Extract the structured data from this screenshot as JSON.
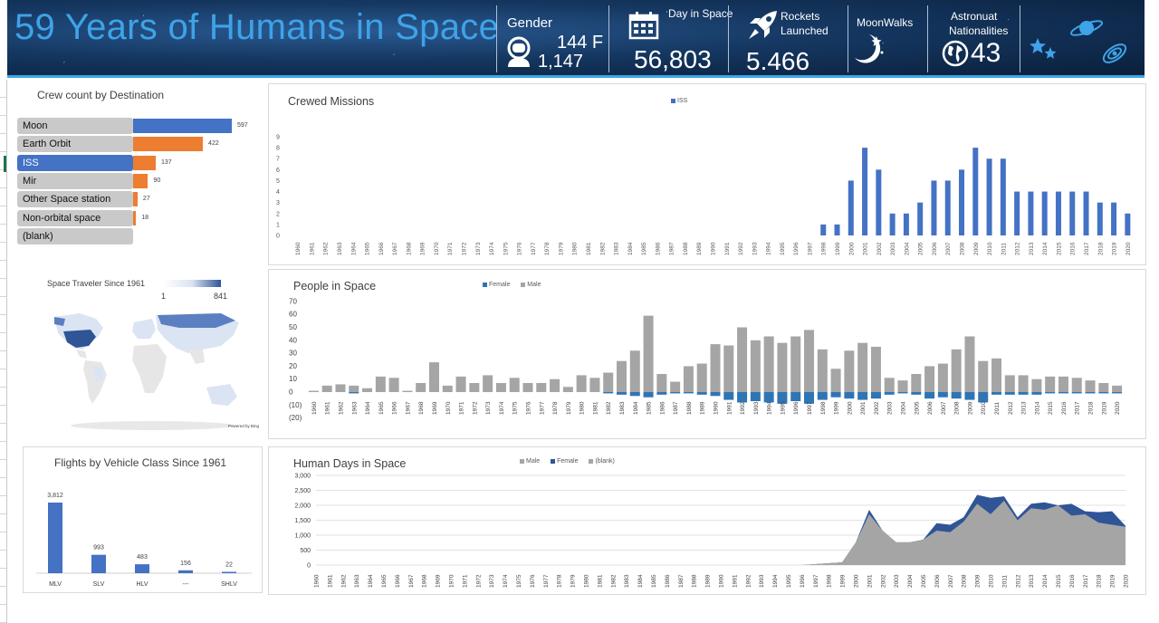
{
  "header": {
    "title": "59 Years of Humans in Space",
    "gender": {
      "label": "Gender",
      "female": "144 F",
      "male": "1,147"
    },
    "days": {
      "label": "Day in Space",
      "value": "56,803"
    },
    "rockets": {
      "label_line1": "Rockets",
      "label_line2": "Launched",
      "value": "5.466"
    },
    "moonwalks": {
      "label": "MoonWalks"
    },
    "nationalities": {
      "label_line1": "Astronuat",
      "label_line2": "Nationalities",
      "value": "43"
    },
    "icons": [
      "astronaut-icon",
      "calendar-icon",
      "rocket-icon",
      "moon-stars-icon",
      "globe-icon",
      "stars-icon",
      "planet-icon",
      "galaxy-icon"
    ],
    "accent": "#3ea3e8"
  },
  "crew_panel": {
    "title": "Crew count by Destination",
    "items": [
      {
        "label": "Moon",
        "value": "597",
        "selected": false,
        "color": "#4472c4"
      },
      {
        "label": "Earth Orbit",
        "value": "422",
        "selected": false,
        "color": "#ed7d31"
      },
      {
        "label": "ISS",
        "value": "137",
        "selected": true,
        "color": "#ed7d31"
      },
      {
        "label": "Mir",
        "value": "90",
        "selected": false,
        "color": "#ed7d31"
      },
      {
        "label": "Other Space station",
        "value": "27",
        "selected": false,
        "color": "#ed7d31"
      },
      {
        "label": "Non-orbital space",
        "value": "18",
        "selected": false,
        "color": "#ed7d31"
      },
      {
        "label": "(blank)",
        "value": "",
        "selected": false,
        "color": "#ed7d31"
      }
    ]
  },
  "map_panel": {
    "title": "Space Traveler Since 1961",
    "scale_min": "1",
    "scale_max": "841",
    "powered": "Powered by Bing"
  },
  "vehicle_panel": {
    "title": "Flights by Vehicle Class Since 1961"
  },
  "crewed_panel": {
    "title": "Crewed Missions",
    "legend": [
      "ISS"
    ]
  },
  "people_panel": {
    "title": "People  in Space",
    "legend": [
      "Female",
      "Male"
    ]
  },
  "days_panel": {
    "title": "Human Days in Space",
    "legend": [
      "Male",
      "Female",
      "(blank)"
    ]
  },
  "chart_data": [
    {
      "id": "crew_by_destination",
      "type": "bar",
      "orientation": "horizontal",
      "categories": [
        "Moon",
        "Earth Orbit",
        "ISS",
        "Mir",
        "Other Space station",
        "Non-orbital space",
        "(blank)"
      ],
      "values": [
        597,
        422,
        137,
        90,
        27,
        18,
        null
      ],
      "title": "Crew count by Destination"
    },
    {
      "id": "crewed_missions",
      "type": "bar",
      "title": "Crewed Missions",
      "years": [
        "1960",
        "1961",
        "1962",
        "1963",
        "1964",
        "1965",
        "1966",
        "1967",
        "1968",
        "1969",
        "1970",
        "1971",
        "1972",
        "1973",
        "1974",
        "1975",
        "1976",
        "1977",
        "1978",
        "1979",
        "1980",
        "1981",
        "1982",
        "1983",
        "1984",
        "1985",
        "1986",
        "1987",
        "1988",
        "1989",
        "1990",
        "1991",
        "1992",
        "1993",
        "1994",
        "1995",
        "1996",
        "1997",
        "1998",
        "1999",
        "2000",
        "2001",
        "2002",
        "2003",
        "2004",
        "2005",
        "2006",
        "2007",
        "2008",
        "2009",
        "2010",
        "2011",
        "2012",
        "2013",
        "2014",
        "2015",
        "2016",
        "2017",
        "2018",
        "2019",
        "2020"
      ],
      "series": [
        {
          "name": "ISS",
          "color": "#4472c4",
          "values": [
            0,
            0,
            0,
            0,
            0,
            0,
            0,
            0,
            0,
            0,
            0,
            0,
            0,
            0,
            0,
            0,
            0,
            0,
            0,
            0,
            0,
            0,
            0,
            0,
            0,
            0,
            0,
            0,
            0,
            0,
            0,
            0,
            0,
            0,
            0,
            0,
            0,
            0,
            1,
            1,
            5,
            8,
            6,
            2,
            2,
            3,
            5,
            5,
            6,
            8,
            7,
            7,
            4,
            4,
            4,
            4,
            4,
            4,
            3,
            3,
            2
          ]
        }
      ],
      "ylim": [
        0,
        9
      ],
      "yticks": [
        0,
        1,
        2,
        3,
        4,
        5,
        6,
        7,
        8,
        9
      ]
    },
    {
      "id": "people_in_space",
      "type": "bar",
      "title": "People  in Space",
      "years": [
        "1960",
        "1961",
        "1962",
        "1963",
        "1964",
        "1965",
        "1966",
        "1967",
        "1968",
        "1969",
        "1970",
        "1971",
        "1972",
        "1973",
        "1974",
        "1975",
        "1976",
        "1977",
        "1978",
        "1979",
        "1980",
        "1981",
        "1982",
        "1983",
        "1984",
        "1985",
        "1986",
        "1987",
        "1988",
        "1989",
        "1990",
        "1991",
        "1992",
        "1993",
        "1994",
        "1995",
        "1996",
        "1997",
        "1998",
        "1999",
        "2000",
        "2001",
        "2002",
        "2003",
        "2004",
        "2005",
        "2006",
        "2007",
        "2008",
        "2009",
        "2010",
        "2011",
        "2012",
        "2013",
        "2014",
        "2015",
        "2016",
        "2017",
        "2018",
        "2019",
        "2020"
      ],
      "series": [
        {
          "name": "Male",
          "color": "#a5a5a5",
          "values": [
            1,
            5,
            6,
            5,
            3,
            12,
            11,
            1,
            7,
            23,
            5,
            12,
            7,
            13,
            7,
            11,
            7,
            7,
            10,
            4,
            13,
            11,
            15,
            24,
            32,
            59,
            14,
            8,
            20,
            22,
            37,
            36,
            50,
            40,
            43,
            38,
            43,
            48,
            33,
            18,
            32,
            38,
            35,
            11,
            9,
            14,
            20,
            22,
            33,
            43,
            24,
            26,
            13,
            13,
            10,
            12,
            12,
            11,
            9,
            7,
            5
          ]
        },
        {
          "name": "Female",
          "color": "#2e75b6",
          "values": [
            0,
            0,
            0,
            -1,
            0,
            0,
            0,
            0,
            0,
            0,
            0,
            0,
            0,
            0,
            0,
            0,
            0,
            0,
            0,
            0,
            0,
            0,
            -1,
            -2,
            -3,
            -4,
            -2,
            -1,
            -1,
            -2,
            -3,
            -6,
            -8,
            -7,
            -8,
            -9,
            -7,
            -9,
            -6,
            -4,
            -5,
            -6,
            -5,
            -2,
            -1,
            -2,
            -5,
            -4,
            -5,
            -6,
            -8,
            -2,
            -2,
            -2,
            -2,
            -1,
            -1,
            -1,
            -1,
            -1,
            -1
          ]
        }
      ],
      "ylim": [
        -20,
        70
      ],
      "ytick_labels": [
        "(20)",
        "(10)",
        "0",
        "10",
        "20",
        "30",
        "40",
        "50",
        "60",
        "70"
      ]
    },
    {
      "id": "human_days_in_space",
      "type": "area",
      "title": "Human Days in Space",
      "years": [
        "1960",
        "1961",
        "1962",
        "1963",
        "1964",
        "1965",
        "1966",
        "1967",
        "1968",
        "1969",
        "1970",
        "1971",
        "1972",
        "1973",
        "1974",
        "1975",
        "1976",
        "1977",
        "1978",
        "1979",
        "1980",
        "1981",
        "1982",
        "1983",
        "1984",
        "1985",
        "1986",
        "1987",
        "1988",
        "1989",
        "1990",
        "1991",
        "1992",
        "1993",
        "1994",
        "1995",
        "1996",
        "1997",
        "1998",
        "1999",
        "2000",
        "2001",
        "2002",
        "2003",
        "2004",
        "2005",
        "2006",
        "2007",
        "2008",
        "2009",
        "2010",
        "2011",
        "2012",
        "2013",
        "2014",
        "2015",
        "2016",
        "2017",
        "2018",
        "2019",
        "2020"
      ],
      "series": [
        {
          "name": "Male",
          "color": "#a5a5a5",
          "values": [
            0,
            0,
            0,
            0,
            0,
            0,
            0,
            0,
            0,
            0,
            0,
            0,
            0,
            0,
            0,
            0,
            0,
            0,
            0,
            0,
            0,
            0,
            0,
            0,
            0,
            0,
            0,
            0,
            0,
            0,
            0,
            0,
            0,
            0,
            0,
            0,
            0,
            30,
            60,
            90,
            750,
            1700,
            1150,
            760,
            760,
            850,
            1150,
            1100,
            1450,
            2050,
            1700,
            2150,
            1500,
            1900,
            1850,
            2000,
            1650,
            1700,
            1420,
            1350,
            1280
          ]
        },
        {
          "name": "Female",
          "color": "#2f5597",
          "values": [
            0,
            0,
            0,
            0,
            0,
            0,
            0,
            0,
            0,
            0,
            0,
            0,
            0,
            0,
            0,
            0,
            0,
            0,
            0,
            0,
            0,
            0,
            0,
            0,
            0,
            0,
            0,
            0,
            0,
            0,
            0,
            0,
            0,
            0,
            0,
            0,
            0,
            0,
            0,
            0,
            0,
            150,
            0,
            0,
            0,
            0,
            250,
            250,
            150,
            300,
            550,
            150,
            100,
            150,
            250,
            0,
            400,
            100,
            350,
            450,
            30
          ]
        }
      ],
      "ylim": [
        0,
        3000
      ],
      "ytick_labels": [
        "0",
        "500",
        "1,000",
        "1,500",
        "2,000",
        "2,500",
        "3,000"
      ]
    },
    {
      "id": "flights_by_vehicle_class",
      "type": "bar",
      "title": "Flights by Vehicle Class Since 1961",
      "categories": [
        "MLV",
        "SLV",
        "HLV",
        "---",
        "SHLV"
      ],
      "values": [
        3812,
        993,
        483,
        156,
        22
      ],
      "value_labels": [
        "3,812",
        "993",
        "483",
        "156",
        "22"
      ]
    }
  ]
}
